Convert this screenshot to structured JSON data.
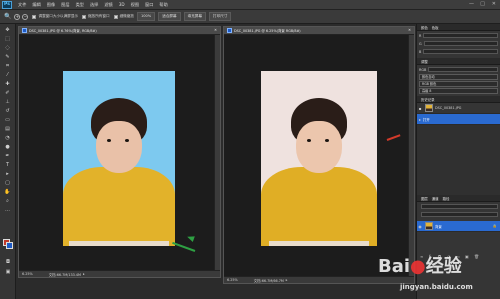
{
  "app": {
    "logo": "Ps",
    "menu": [
      "文件",
      "编辑",
      "图像",
      "图层",
      "类型",
      "选择",
      "滤镜",
      "3D",
      "视图",
      "窗口",
      "帮助"
    ],
    "window_controls": [
      "—",
      "□",
      "✕"
    ]
  },
  "options_bar": {
    "check1": "调整窗口大小以满屏显示",
    "check2": "缩放所有窗口",
    "check3": "细微缩放",
    "btn_100": "100%",
    "btn_fit": "适合屏幕",
    "btn_fill": "填充屏幕",
    "btn_print": "打印尺寸"
  },
  "documents": {
    "left": {
      "tab_title": "DSC_00381.JPG @ 6.76%(背景, RGB/8#)",
      "zoom": "6.25%",
      "doc_info": "文档:66.7M/133.4M",
      "bg_color": "#7dc9ef"
    },
    "right": {
      "tab_title": "DSC_00381.JPG @ 6.25%(背景 RGB/8#)",
      "zoom": "6.25%",
      "doc_info": "文档:66.7M/66.7M",
      "bg_color": "#efe2df"
    }
  },
  "panels": {
    "top_tabs": [
      "颜色",
      "色板"
    ],
    "properties_label": "调整",
    "channel_label": "RGB",
    "dropdown1": "颜色自动",
    "dropdown2": "RGB 颜色",
    "dropdown3": "高级 8",
    "layers_header": "图层",
    "layer1_name": "DSC_00381.JPG",
    "layer2_name": "背景",
    "history_header": "历史记录",
    "history_item": "打开",
    "bottom_tabs": [
      "图层",
      "通道",
      "路径"
    ],
    "bottom_layer": "背景",
    "bottom_layer_lock": "🔒"
  },
  "watermark": {
    "brand": "Bai",
    "paw": "du",
    "suffix": "经验",
    "url": "jingyan.baidu.com"
  },
  "colors": {
    "accent": "#2a6ad0",
    "arrow_green": "#2ea043",
    "arrow_red": "#d23a2a",
    "coat_yellow": "#e2b22a",
    "fg_swatch": "#c0392b",
    "bg_swatch": "#1e5bc6"
  }
}
